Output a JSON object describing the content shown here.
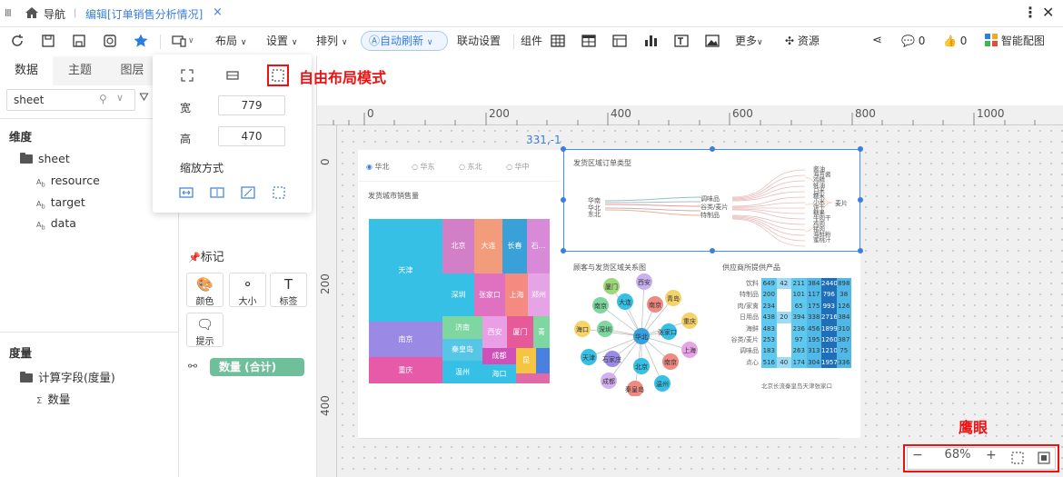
{
  "tabbar": {
    "nav_label": "导航",
    "active_tab": "编辑[订单销售分析情况]",
    "close_glyph": "×"
  },
  "toolbar": {
    "layout_label": "布局",
    "settings_label": "设置",
    "arrange_label": "排列",
    "autorefresh_label": "自动刷新",
    "linkage_label": "联动设置",
    "component_label": "组件",
    "more_label": "更多",
    "resource_label": "资源",
    "comment_count": "0",
    "like_count": "0",
    "smart_label": "智能配图"
  },
  "layout_popup": {
    "width_label": "宽",
    "width_value": "779",
    "height_label": "高",
    "height_value": "470",
    "scale_label": "缩放方式",
    "free_layout_note": "自由布局模式"
  },
  "left_panel": {
    "tabs": [
      "数据",
      "主题",
      "图层"
    ],
    "search_value": "sheet",
    "dimension_title": "维度",
    "sheet_folder": "sheet",
    "fields": [
      "resource",
      "target",
      "data"
    ],
    "measure_title": "度量",
    "measure_folder": "计算字段(度量)",
    "measure_field": "数量"
  },
  "mark_panel": {
    "title": "标记",
    "buttons": [
      "颜色",
      "大小",
      "标签",
      "提示"
    ],
    "measure_pill": "数量 (合计)"
  },
  "ruler": {
    "h_ticks": [
      "0",
      "200",
      "400",
      "600",
      "800",
      "1000"
    ],
    "v_ticks": [
      "0",
      "200",
      "400"
    ],
    "coord": "331,-1"
  },
  "dashboard": {
    "radio_options": [
      "华北",
      "华东",
      "东北",
      "华中"
    ],
    "treemap_title": "发货城市销售量",
    "treemap_cells": [
      "天津",
      "北京",
      "大连",
      "长春",
      "石...",
      "深圳",
      "张家口",
      "上海",
      "郑州",
      "南京",
      "济南",
      "西安",
      "厦门",
      "青",
      "重庆",
      "秦皇岛",
      "成都",
      "昆",
      "温州",
      "海口"
    ],
    "sankey_title": "发货区域订单类型",
    "sankey_left": [
      "华南",
      "华北",
      "东北"
    ],
    "sankey_mid": [
      "调味品",
      "谷类/麦片",
      "特制品"
    ],
    "sankey_right": [
      "酱油",
      "海苔酱",
      "鸡精",
      "蚝油",
      "白米",
      "糯米",
      "小米",
      "饼干",
      "糖果",
      "牛肉干",
      "鸡肉",
      "猪肉",
      "海鲜粉",
      "蜜桃汁",
      "麦片"
    ],
    "graph_title": "顾客与发货区域关系图",
    "graph_nodes": [
      "大连",
      "厦门",
      "西安",
      "南京",
      "青岛",
      "海口",
      "深圳",
      "华北",
      "张家口",
      "重庆",
      "天津",
      "石家庄",
      "北京",
      "上海",
      "南京",
      "成都",
      "秦皇岛",
      "温州"
    ],
    "heat_title": "供应商所提供产品",
    "heat_rows": [
      "饮料",
      "特制品",
      "肉/家禽",
      "日用品",
      "海鲜",
      "谷类/麦片",
      "调味品",
      "点心"
    ],
    "heat_values": [
      [
        "649",
        "42",
        "211",
        "384",
        "2440",
        "898"
      ],
      [
        "200",
        "",
        "101",
        "117",
        "796",
        "38"
      ],
      [
        "234",
        "",
        "65",
        "175",
        "993",
        "126"
      ],
      [
        "438",
        "20",
        "394",
        "338",
        "2716",
        "384"
      ],
      [
        "483",
        "",
        "236",
        "456",
        "1899",
        "310"
      ],
      [
        "253",
        "",
        "97",
        "195",
        "1260",
        "387"
      ],
      [
        "183",
        "",
        "263",
        "313",
        "1210",
        "75"
      ],
      [
        "516",
        "40",
        "174",
        "304",
        "1957",
        "336"
      ]
    ],
    "heat_cols": "北京长流秦皇岛天津张家口"
  },
  "eagle_eye": {
    "label": "鹰眼",
    "zoom": "68%",
    "minus": "−",
    "plus": "+"
  }
}
